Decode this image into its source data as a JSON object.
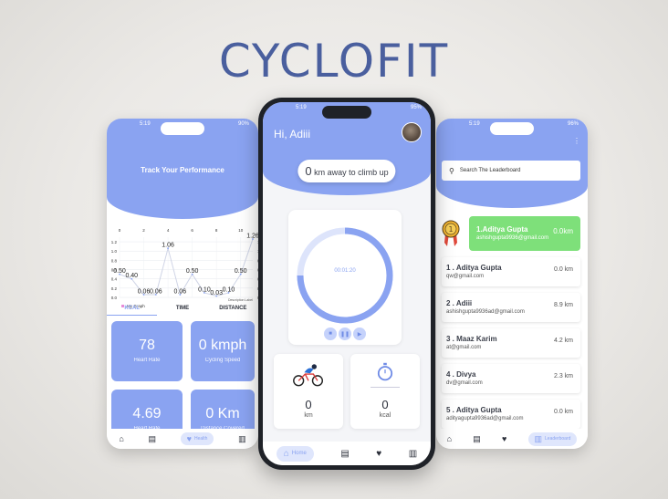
{
  "brand": "CYCLOFIT",
  "left_phone": {
    "status_time": "5:19",
    "status_right": "90%",
    "title": "Track Your Performance",
    "chart_data": {
      "type": "line",
      "x": [
        0,
        1,
        2,
        3,
        4,
        5,
        6,
        7,
        8,
        9,
        10,
        11
      ],
      "values": [
        0.5,
        0.4,
        0.06,
        0.06,
        1.06,
        0.06,
        0.5,
        0.1,
        0.03,
        0.1,
        0.5,
        1.26
      ],
      "data_labels": [
        "0.50",
        "0.40",
        "0.06",
        "0.06",
        "1.06",
        "0.06",
        "0.50",
        "0.10",
        "0.03",
        "0.10",
        "0.50",
        "1.26"
      ],
      "x_ticks": [
        "0",
        "2",
        "4",
        "6",
        "8",
        "10"
      ],
      "y_ticks": [
        "1.2",
        "1.0",
        "0.8",
        "0.6",
        "0.4",
        "0.2",
        "0.0"
      ],
      "ylim": [
        0,
        1.3
      ],
      "legend": "My Graph",
      "annotation": "Description Label",
      "line_color": "#cfd4e6",
      "grid": true
    },
    "tabs": [
      "KCAL",
      "TIME",
      "DISTANCE"
    ],
    "cards": [
      {
        "value": "78",
        "label": "Heart Rate"
      },
      {
        "value": "0 kmph",
        "label": "Cycling Speed"
      },
      {
        "value": "4.69",
        "label": "Heart Rate"
      },
      {
        "value": "0 Km",
        "label": "Distance Covered"
      }
    ],
    "nav_active": "Health"
  },
  "center_phone": {
    "status_time": "5:19",
    "status_right": "95%",
    "greeting": "Hi, Adiii",
    "pill_number": "0",
    "pill_text": " km away to climb up",
    "timer": "00:01:20",
    "progress_fraction": 0.75,
    "cards": [
      {
        "value": "0",
        "unit": "km"
      },
      {
        "value": "0",
        "unit": "kcal"
      }
    ],
    "nav_active": "Home"
  },
  "right_phone": {
    "status_time": "5:19",
    "status_right": "96%",
    "search_placeholder": "Search The Leaderboard",
    "first": {
      "name": "1.Aditya Gupta",
      "email": "ashishgupta9936@gmail.com",
      "distance": "0.0km"
    },
    "rows": [
      {
        "name": "1 . Aditya Gupta",
        "email": "qw@gmail.com",
        "distance": "0.0 km"
      },
      {
        "name": "2 . Adiii",
        "email": "ashishgupta9936ad@gmail.com",
        "distance": "8.9 km"
      },
      {
        "name": "3 . Maaz Karim",
        "email": "at@gmail.com",
        "distance": "4.2 km"
      },
      {
        "name": "4 . Divya",
        "email": "dv@gmail.com",
        "distance": "2.3 km"
      },
      {
        "name": "5 . Aditya Gupta",
        "email": "adityagupta9936ad@gmail.com",
        "distance": "0.0 km"
      }
    ],
    "nav_active": "Leaderboard"
  },
  "colors": {
    "accent": "#8aa3f1",
    "brand": "#4a5f9e",
    "highlight": "#7ee07a"
  }
}
